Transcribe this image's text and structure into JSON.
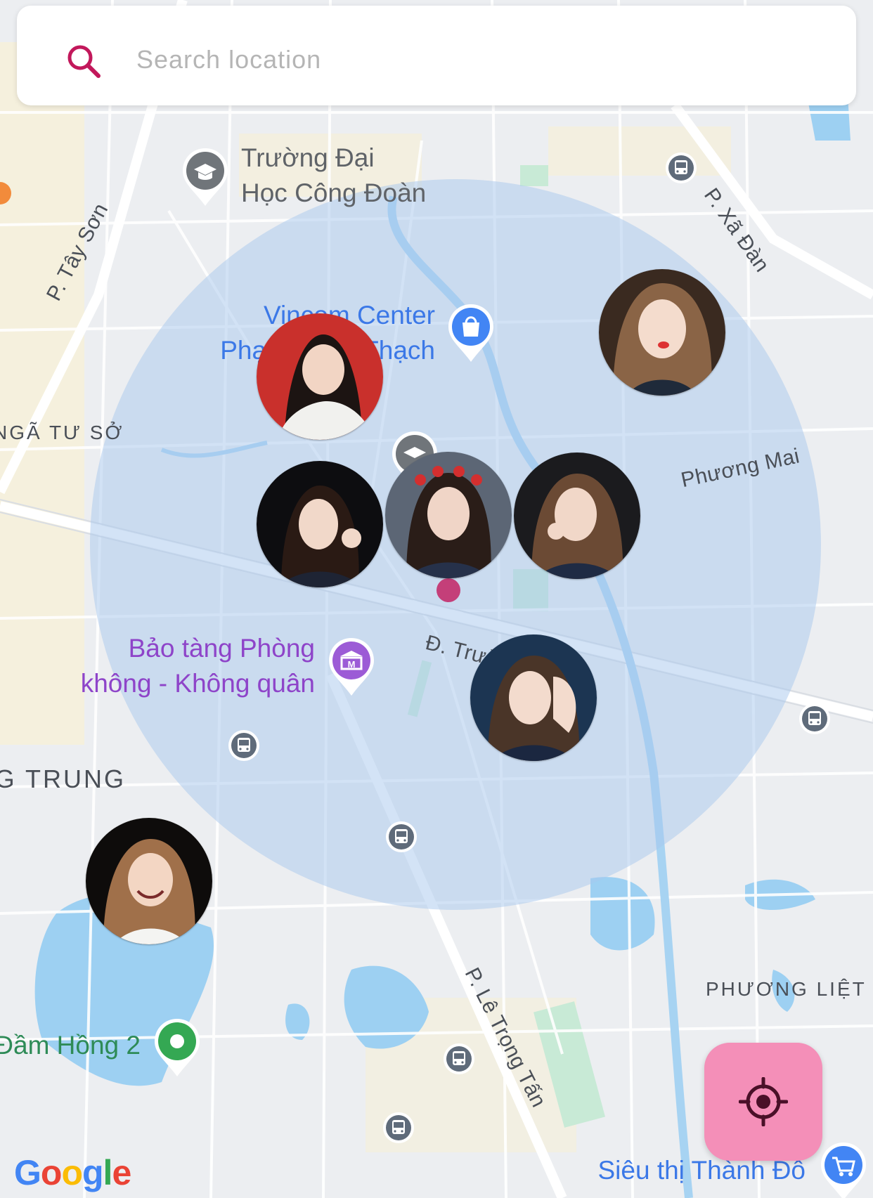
{
  "search": {
    "placeholder": "Search location"
  },
  "map": {
    "poi_labels": {
      "truong_dai_hoc_line1": "Trường Đại",
      "truong_dai_hoc_line2": "Học Công Đoàn",
      "vincom_line1": "Vincom Center",
      "vincom_line2": "Phạm Ngọc Thạch",
      "bao_tang_line1": "Bảo tàng Phòng",
      "bao_tang_line2": "không - Không quân",
      "dam_hong": "Đầm Hồng 2",
      "sieu_thi": "Siêu thị Thành Đô"
    },
    "street_labels": {
      "tay_son": "P. Tây Sơn",
      "xa_dan": "P. Xã Đàn",
      "phuong_mai": "Phương Mai",
      "truong_chinh": "Đ. Trường Chinh",
      "le_trong_tan": "P. Lê Trọng Tấn"
    },
    "district_labels": {
      "nga_tu_so": "NGÃ TƯ SỞ",
      "khuong_trung": "KHƯƠNG TRUNG",
      "phuong_liet": "PHƯƠNG LIỆT"
    },
    "attribution": "Google",
    "colors": {
      "radius_fill": "#a8c8ee",
      "accent": "#c2185b",
      "locate_button": "#f48fb8",
      "poi_blue": "#4285f4",
      "poi_purple": "#9c5bd6",
      "poi_green": "#34a853",
      "poi_gray": "#70757a"
    }
  },
  "user_markers": [
    {
      "name": "user-avatar-1"
    },
    {
      "name": "user-avatar-2"
    },
    {
      "name": "user-avatar-3"
    },
    {
      "name": "user-avatar-4"
    },
    {
      "name": "user-avatar-5"
    },
    {
      "name": "user-avatar-6"
    },
    {
      "name": "user-avatar-7"
    }
  ],
  "controls": {
    "locate_icon": "crosshair-icon"
  }
}
